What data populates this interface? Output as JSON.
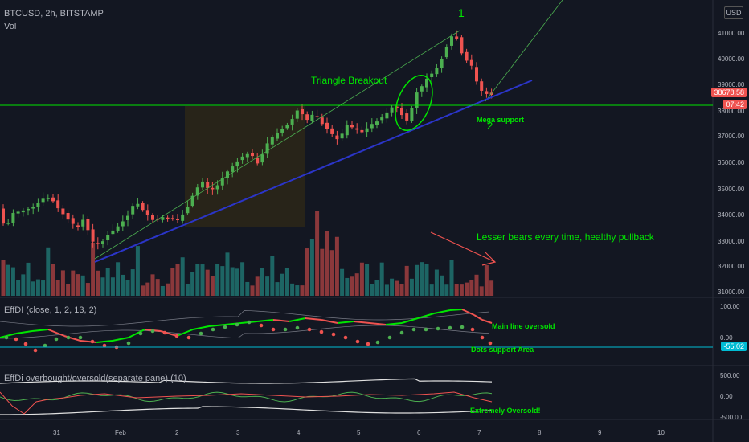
{
  "header": {
    "symbol_line": "BTCUSD, 2h, BITSTAMP",
    "vol_label": "Vol",
    "currency_button": "USD"
  },
  "price_axis": {
    "ticks": [
      "41000.00",
      "40000.00",
      "39000.00",
      "38000.00",
      "37000.00",
      "36000.00",
      "35000.00",
      "34000.00",
      "33000.00",
      "32000.00",
      "31000.00"
    ],
    "last_price": "38678.58",
    "countdown": "07:42"
  },
  "time_axis": [
    "31",
    "Feb",
    "2",
    "3",
    "4",
    "5",
    "6",
    "7",
    "8",
    "9",
    "10"
  ],
  "indicator1": {
    "title": "EffDI (close, 1, 2, 13, 2)",
    "ticks": [
      "100.00",
      "0.00"
    ],
    "tag": "-55.02"
  },
  "indicator2": {
    "title": "EffDi overbought/oversold(separate pane) (10)",
    "ticks": [
      "500.00",
      "0.00",
      "-500.00"
    ]
  },
  "annotations": {
    "wave1": "1",
    "wave2": "2",
    "triangle": "Triangle Breakout",
    "mega_support": "Mega support",
    "lesser_bears": "Lesser bears every time, healthy pullback",
    "main_line": "Main line oversold",
    "dots_support": "Dots support Area",
    "extremely": "Extremely Oversold!"
  },
  "colors": {
    "bull": "#26a69a",
    "bull_candle": "#4caf50",
    "bear": "#ef5350",
    "green": "#00e600",
    "blue": "#2b35c9",
    "cyan": "#00bcd4"
  }
}
